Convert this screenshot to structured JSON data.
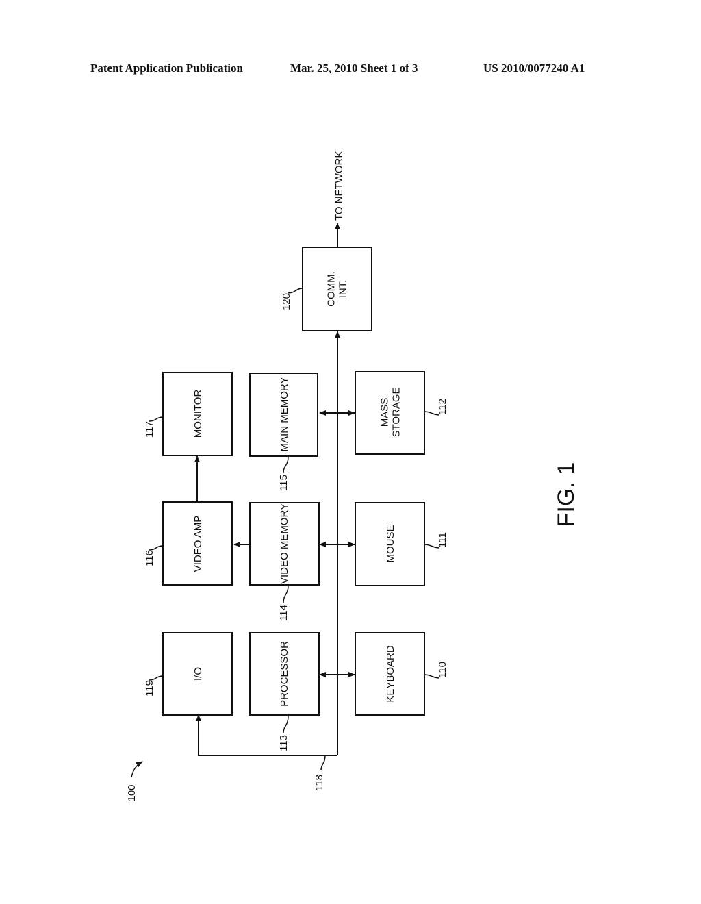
{
  "header": {
    "publication": "Patent Application Publication",
    "date_sheet": "Mar. 25, 2010  Sheet 1 of 3",
    "number": "US 2010/0077240 A1"
  },
  "figure": {
    "label": "FIG. 1",
    "system_ref": "100",
    "bus_ref": "118",
    "network_label": "TO NETWORK"
  },
  "blocks": [
    {
      "id": "io",
      "ref": "119",
      "lines": [
        "I/O"
      ]
    },
    {
      "id": "processor",
      "ref": "113",
      "lines": [
        "PROCESSOR"
      ]
    },
    {
      "id": "keyboard",
      "ref": "110",
      "lines": [
        "KEYBOARD"
      ]
    },
    {
      "id": "video-amp",
      "ref": "116",
      "lines": [
        "VIDEO AMP"
      ]
    },
    {
      "id": "video-memory",
      "ref": "114",
      "lines": [
        "VIDEO MEMORY"
      ]
    },
    {
      "id": "mouse",
      "ref": "111",
      "lines": [
        "MOUSE"
      ]
    },
    {
      "id": "monitor",
      "ref": "117",
      "lines": [
        "MONITOR"
      ]
    },
    {
      "id": "main-memory",
      "ref": "115",
      "lines": [
        "MAIN MEMORY"
      ]
    },
    {
      "id": "mass-storage",
      "ref": "112",
      "lines": [
        "MASS",
        "STORAGE"
      ]
    },
    {
      "id": "comm-int",
      "ref": "120",
      "lines": [
        "COMM.",
        "INT."
      ]
    }
  ]
}
